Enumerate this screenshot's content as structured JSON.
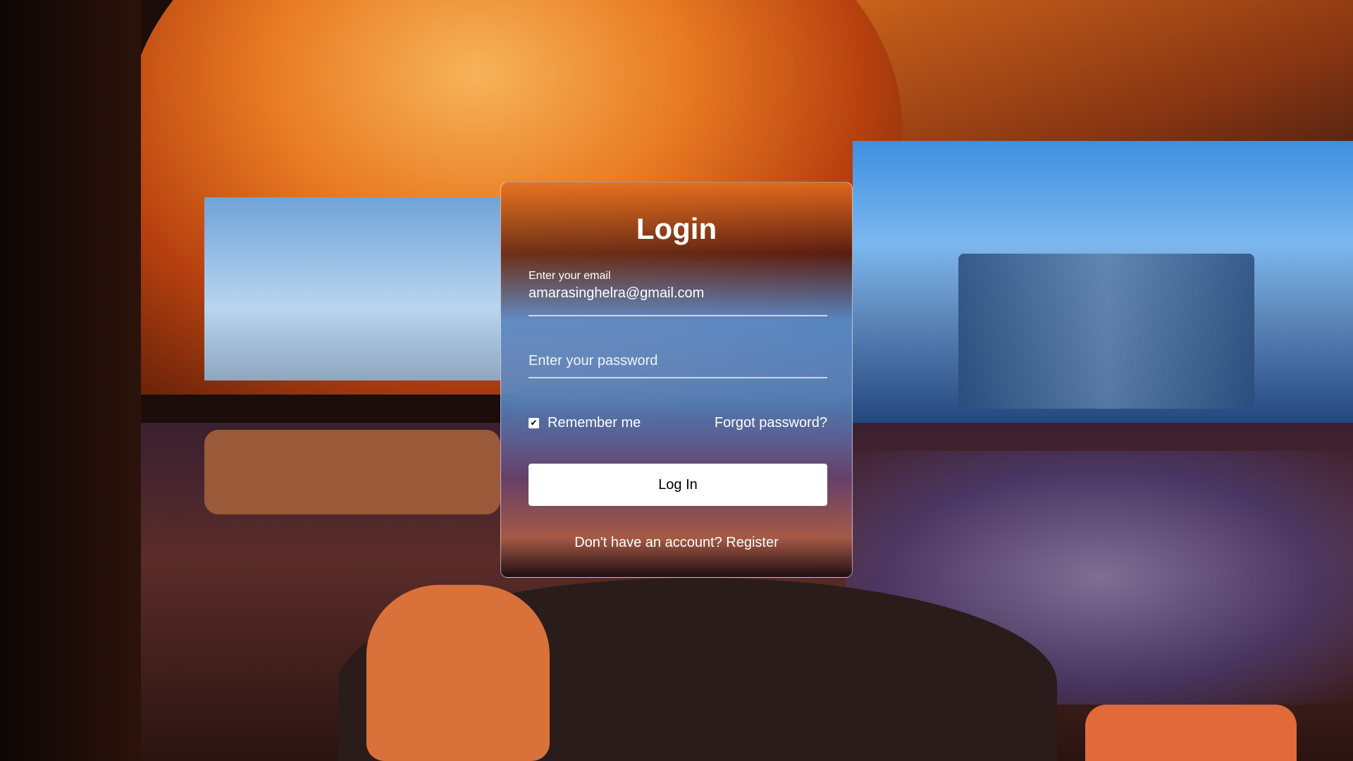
{
  "login": {
    "title": "Login",
    "email_label": "Enter your email",
    "email_value": "amarasinghelra@gmail.com",
    "password_placeholder": "Enter your password",
    "remember_label": "Remember me",
    "remember_checked": true,
    "forgot_link": "Forgot password?",
    "submit_label": "Log In",
    "register_text": "Don't have an account? Register"
  }
}
